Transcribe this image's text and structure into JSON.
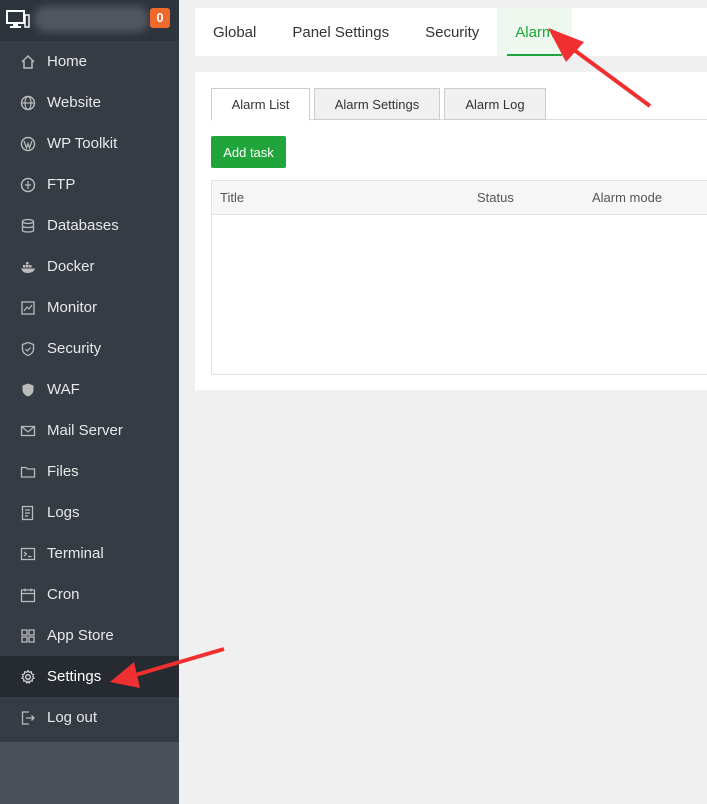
{
  "header": {
    "notification_count": "0"
  },
  "sidebar": {
    "items": [
      {
        "label": "Home",
        "icon": "home-icon"
      },
      {
        "label": "Website",
        "icon": "globe-icon"
      },
      {
        "label": "WP Toolkit",
        "icon": "wordpress-icon"
      },
      {
        "label": "FTP",
        "icon": "ftp-icon"
      },
      {
        "label": "Databases",
        "icon": "database-icon"
      },
      {
        "label": "Docker",
        "icon": "docker-icon"
      },
      {
        "label": "Monitor",
        "icon": "monitor-chart-icon"
      },
      {
        "label": "Security",
        "icon": "shield-icon"
      },
      {
        "label": "WAF",
        "icon": "waf-shield-icon"
      },
      {
        "label": "Mail Server",
        "icon": "mail-icon"
      },
      {
        "label": "Files",
        "icon": "folder-icon"
      },
      {
        "label": "Logs",
        "icon": "log-icon"
      },
      {
        "label": "Terminal",
        "icon": "terminal-icon"
      },
      {
        "label": "Cron",
        "icon": "calendar-icon"
      },
      {
        "label": "App Store",
        "icon": "grid-icon"
      },
      {
        "label": "Settings",
        "icon": "gear-icon"
      },
      {
        "label": "Log out",
        "icon": "logout-icon"
      }
    ],
    "active": "Settings"
  },
  "top_tabs": {
    "items": [
      "Global",
      "Panel Settings",
      "Security",
      "Alarm"
    ],
    "active": "Alarm"
  },
  "sub_tabs": {
    "items": [
      "Alarm List",
      "Alarm Settings",
      "Alarm Log"
    ],
    "active": "Alarm List"
  },
  "toolbar": {
    "add_task_label": "Add task"
  },
  "table": {
    "columns": [
      "Title",
      "Status",
      "Alarm mode"
    ],
    "rows": []
  },
  "colors": {
    "accent": "#20a53a",
    "sidebar_bg": "#353c44",
    "sidebar_active": "#262b31",
    "badge": "#f0682a",
    "annotation_arrow": "#f03030"
  }
}
